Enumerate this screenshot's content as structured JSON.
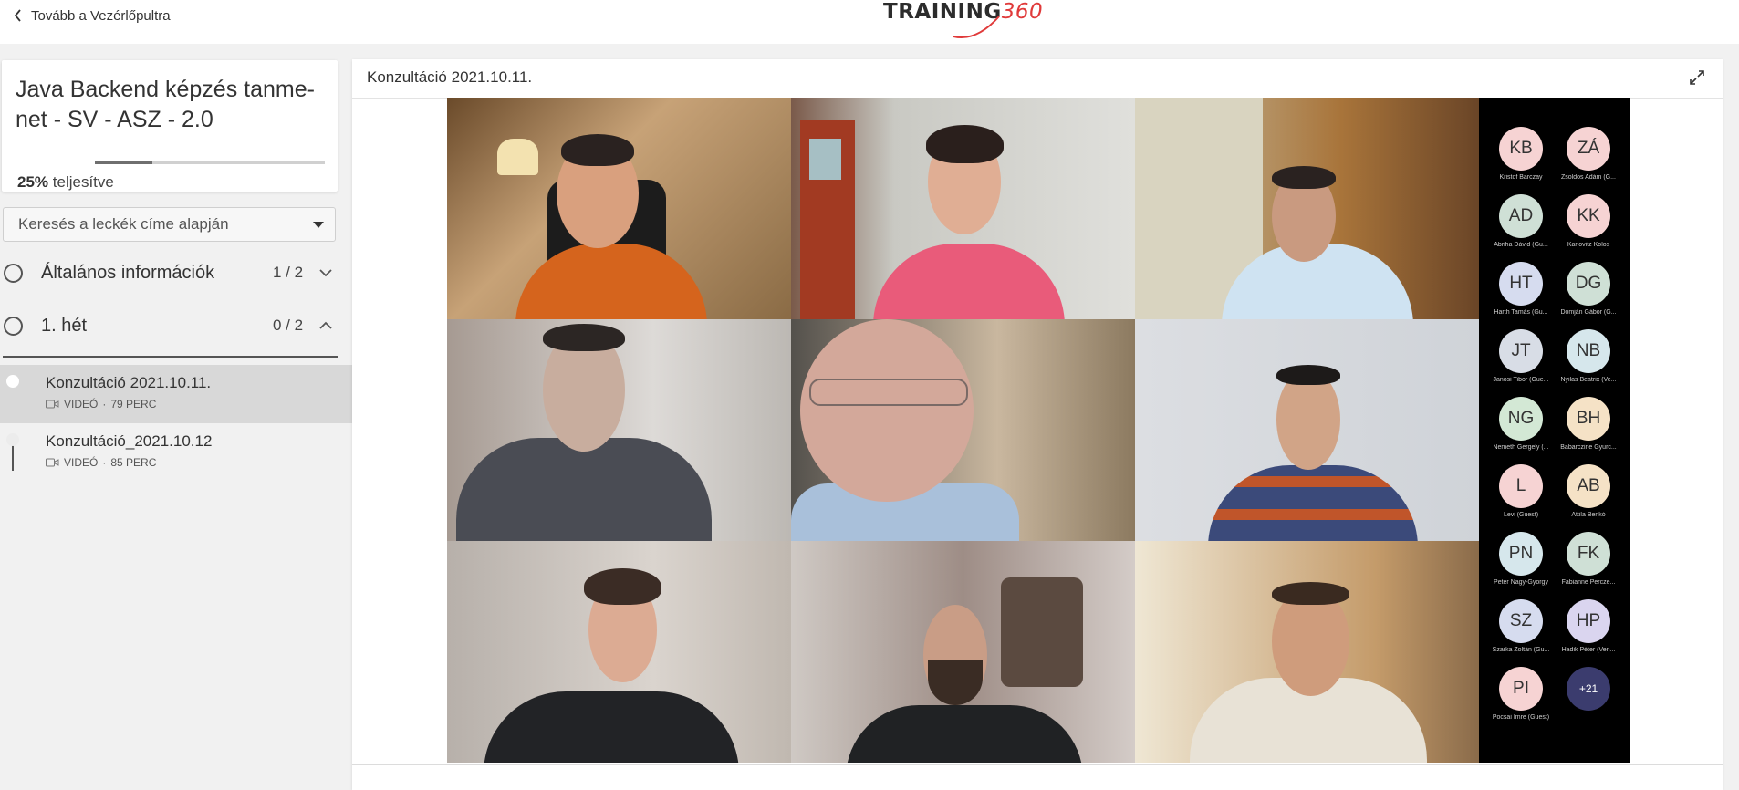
{
  "topbar": {
    "back_label": "Tovább a Vezérlőpultra",
    "logo_text": "TRAINING",
    "logo_num": "360"
  },
  "course": {
    "title": "Java Backend képzés tanme-net - SV - ASZ - 2.0",
    "progress_percent": "25%",
    "progress_suffix": "teljesítve",
    "progress_fraction": 0.25
  },
  "search": {
    "placeholder": "Keresés a leckék címe alapján"
  },
  "sections": [
    {
      "title": "Általános információk",
      "count": "1 / 2",
      "expanded": false
    },
    {
      "title": "1. hét",
      "count": "0 / 2",
      "expanded": true
    }
  ],
  "lessons": [
    {
      "title": "Konzultáció 2021.10.11.",
      "type": "VIDEÓ",
      "duration": "79 PERC",
      "active": true
    },
    {
      "title": "Konzultáció_2021.10.12",
      "type": "VIDEÓ",
      "duration": "85 PERC",
      "active": false
    }
  ],
  "main": {
    "title": "Konzultáció 2021.10.11."
  },
  "participants": [
    {
      "initials": "KB",
      "name": "Kristof Barczay",
      "color": "#f6d3d3"
    },
    {
      "initials": "ZÁ",
      "name": "Zsoldos Adám (G...",
      "color": "#f6d3d3"
    },
    {
      "initials": "AD",
      "name": "Abriha Dávid (Gu...",
      "color": "#cfe0d6"
    },
    {
      "initials": "KK",
      "name": "Karlovitz Kolos",
      "color": "#f6d3d3"
    },
    {
      "initials": "HT",
      "name": "Harth Tamás (Gu...",
      "color": "#d6dcef"
    },
    {
      "initials": "DG",
      "name": "Domján Gábor (G...",
      "color": "#cfe0d6"
    },
    {
      "initials": "JT",
      "name": "Janosi Tibor (Gue...",
      "color": "#d8dde6"
    },
    {
      "initials": "NB",
      "name": "Nyilas Beatrix (Ve...",
      "color": "#d6e7ec"
    },
    {
      "initials": "NG",
      "name": "Nemeth Gergely (...",
      "color": "#d3e8d5"
    },
    {
      "initials": "BH",
      "name": "Babarczine Gyurc...",
      "color": "#f5e2c6"
    },
    {
      "initials": "L",
      "name": "Levi (Guest)",
      "color": "#f6d3d3"
    },
    {
      "initials": "AB",
      "name": "Attila Benkó",
      "color": "#f5e2c6"
    },
    {
      "initials": "PN",
      "name": "Peter Nagy-Gyorgy",
      "color": "#d6e7ec"
    },
    {
      "initials": "FK",
      "name": "Fabianne Percze...",
      "color": "#cfe0d6"
    },
    {
      "initials": "SZ",
      "name": "Szarka Zoltán (Gu...",
      "color": "#d6dcef"
    },
    {
      "initials": "HP",
      "name": "Hadik Péter (Ven...",
      "color": "#dad5ef"
    },
    {
      "initials": "PI",
      "name": "Pocsai Imre (Guest)",
      "color": "#f6d3d3"
    },
    {
      "initials": "+21",
      "name": "",
      "color": "#3b3c6e"
    }
  ]
}
